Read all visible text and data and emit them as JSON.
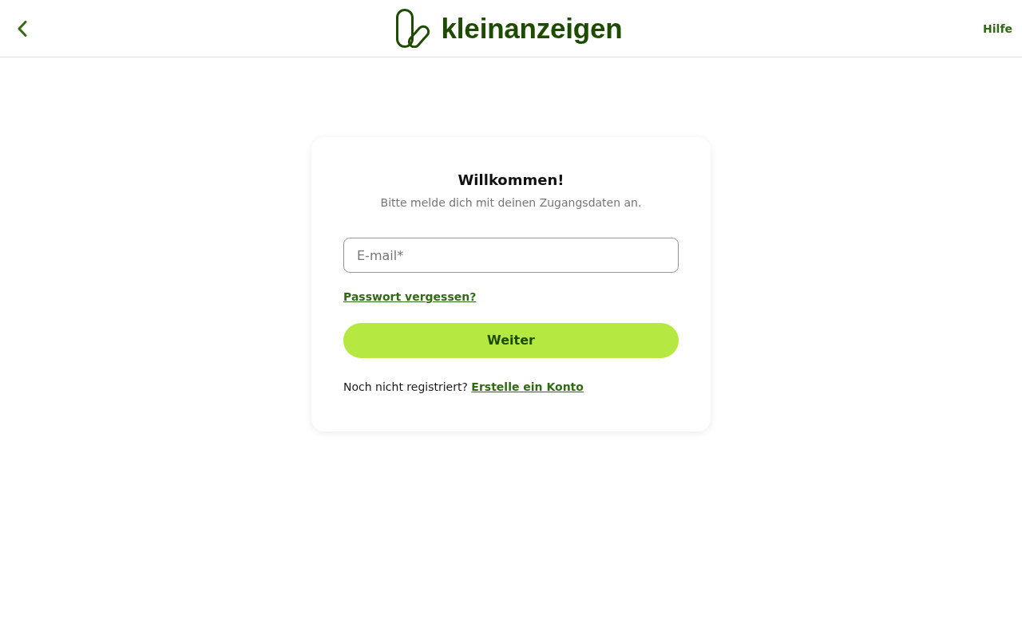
{
  "header": {
    "logo": {
      "wordmark": "kleinanzeigen"
    },
    "help_link": "Hilfe"
  },
  "login_card": {
    "title": "Willkommen!",
    "subtitle": "Bitte melde dich mit deinen Zugangsdaten an.",
    "email_field": {
      "placeholder": "E-mail*"
    },
    "forgot_password_link": "Passwort vergessen?",
    "submit_button": "Weiter",
    "register_prompt": {
      "text": "Noch nicht registriert?",
      "link": "Erstelle ein Konto"
    }
  }
}
